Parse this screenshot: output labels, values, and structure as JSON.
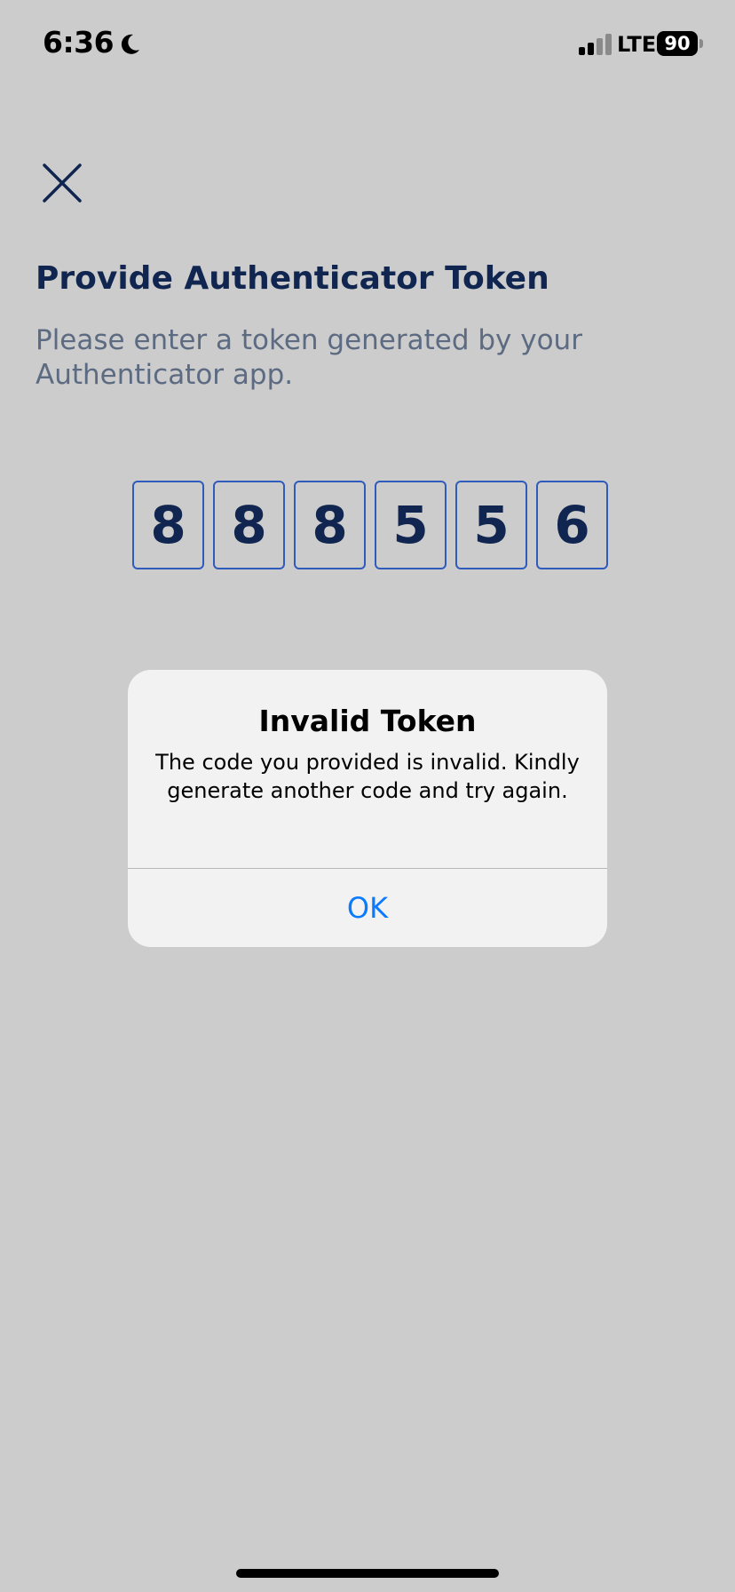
{
  "status_bar": {
    "time": "6:36",
    "network": "LTE",
    "battery_percent": "90",
    "battery_level": 0.9,
    "icons": [
      "moon-icon",
      "signal-icon"
    ]
  },
  "header": {
    "close_icon": "close-icon",
    "title": "Provide Authenticator Token",
    "subtitle": "Please enter a token generated by your Authenticator app."
  },
  "token": {
    "digits": [
      "8",
      "8",
      "8",
      "5",
      "5",
      "6"
    ]
  },
  "alert": {
    "title": "Invalid Token",
    "message": "The code you provided is invalid. Kindly generate another code and try again.",
    "ok_label": "OK"
  },
  "colors": {
    "background": "#cccccc",
    "title": "#10254f",
    "subtitle": "#5c6b82",
    "token_border": "#2f5bbd",
    "alert_background": "#f2f2f2",
    "alert_button": "#0a7aff"
  }
}
